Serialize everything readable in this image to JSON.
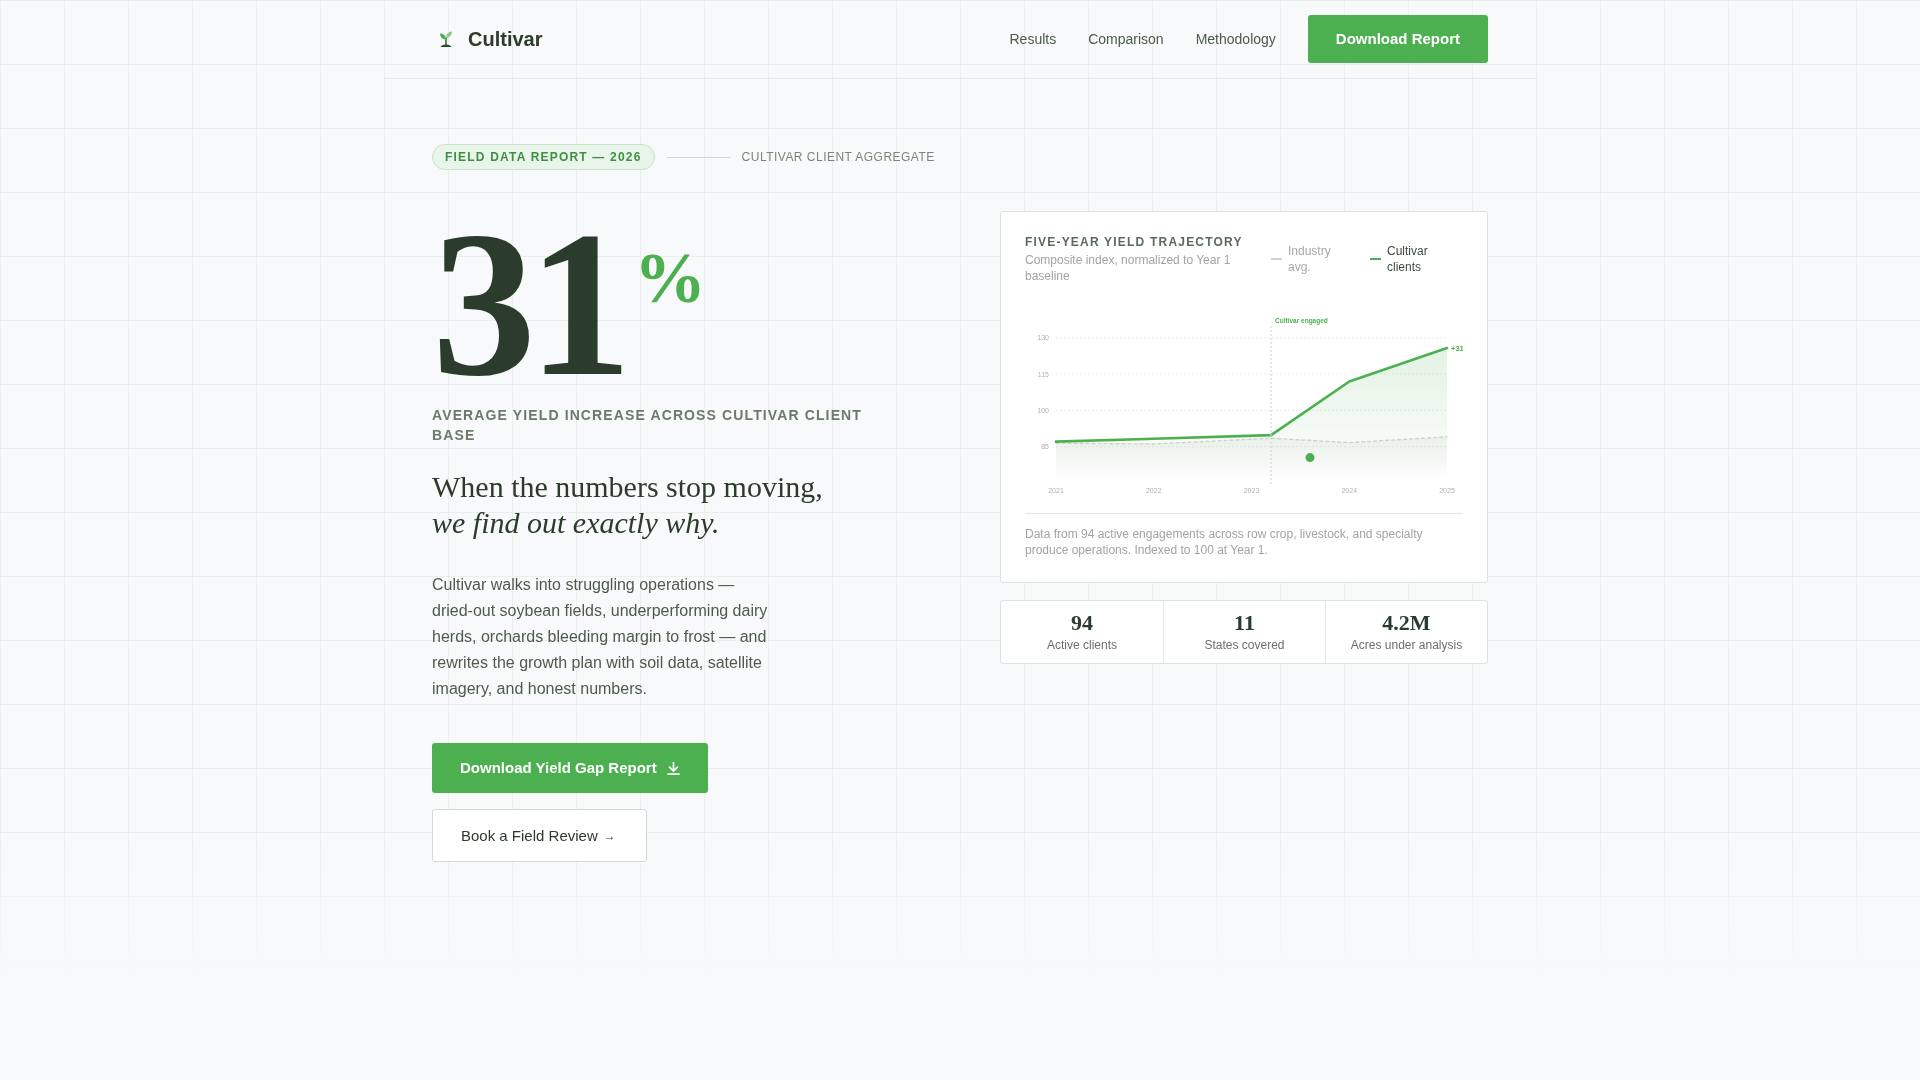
{
  "header": {
    "brand": "Cultivar",
    "nav": [
      {
        "label": "Results"
      },
      {
        "label": "Comparison"
      },
      {
        "label": "Methodology"
      }
    ],
    "cta": {
      "label": "Download Report"
    }
  },
  "hero": {
    "badge": "FIELD DATA REPORT — 2026",
    "eyebrow": "CULTIVAR CLIENT AGGREGATE",
    "stat": {
      "value": "31",
      "unit": "%",
      "label": "AVERAGE YIELD INCREASE ACROSS CULTIVAR CLIENT BASE"
    },
    "headline": "When the numbers stop moving, *we find out exactly why.*",
    "body": "Cultivar walks into struggling operations — dried-out soybean fields, underperforming dairy herds, orchards bleeding margin to frost — and rewrites the growth plan with soil data, satellite imagery, and honest numbers.",
    "buttons": [
      {
        "kind": "primary",
        "label": "Download Yield Gap Report"
      },
      {
        "kind": "secondary",
        "label": "Book a Field Review",
        "arrow": "→"
      }
    ]
  },
  "chart_card": {
    "title": "FIVE-YEAR YIELD TRAJECTORY",
    "subtitle": "Composite index, normalized to Year 1 baseline",
    "chart_data": {
      "type": "area",
      "x": [
        2021,
        2022,
        2023.2,
        2024,
        2025
      ],
      "series": [
        {
          "name": "Industry avg.",
          "color": "#cfd3cf",
          "values": [
            86.4,
            86.1,
            88.5,
            86.7,
            89.1
          ]
        },
        {
          "name": "Cultivar clients",
          "color": "#4caf50",
          "values": [
            87.1,
            88.3,
            89.8,
            111.9,
            125.7
          ]
        }
      ],
      "xlim": [
        2021,
        2025
      ],
      "ylim": [
        85,
        130
      ],
      "xticks": [
        2021,
        2022,
        2023,
        2024,
        2025
      ],
      "yticks": [
        85,
        100,
        115,
        130
      ],
      "grid": true,
      "ref_lines": [
        {
          "axis": "x",
          "value": 2023.2,
          "label": "Cultivar engaged"
        }
      ],
      "annotations": [
        {
          "text": "+31"
        }
      ]
    },
    "footnote": "Data from 94 active engagements across row crop, livestock, and specialty produce operations. Indexed to 100 at Year 1."
  },
  "stats": [
    {
      "value": "94",
      "label": "Active clients"
    },
    {
      "value": "11",
      "label": "States covered"
    },
    {
      "value": "4.2M",
      "label": "Acres under analysis"
    }
  ]
}
